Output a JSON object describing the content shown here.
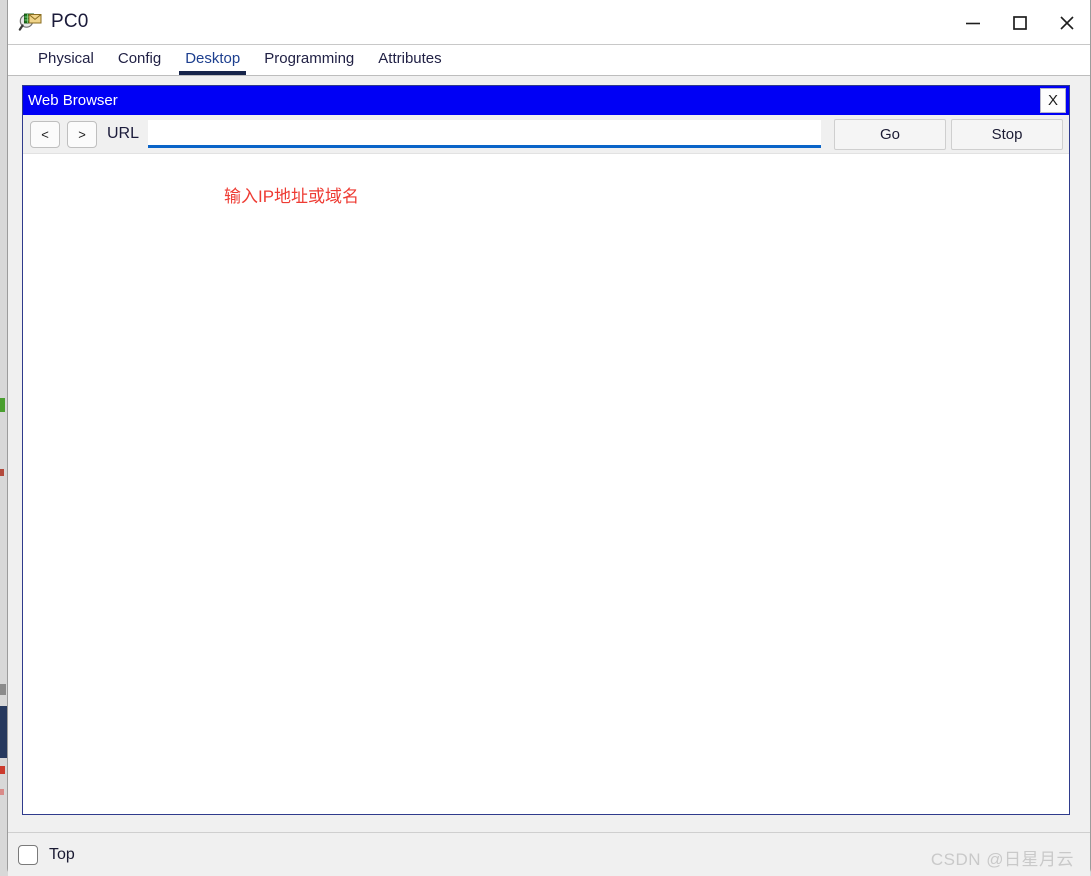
{
  "window": {
    "title": "PC0",
    "icon": "inspect-envelope-icon",
    "controls": {
      "minimize": "minimize-icon",
      "maximize": "maximize-icon",
      "close": "close-icon"
    }
  },
  "tabs": [
    {
      "label": "Physical",
      "selected": false
    },
    {
      "label": "Config",
      "selected": false
    },
    {
      "label": "Desktop",
      "selected": true
    },
    {
      "label": "Programming",
      "selected": false
    },
    {
      "label": "Attributes",
      "selected": false
    }
  ],
  "browser": {
    "caption": "Web Browser",
    "close_label": "X",
    "back_label": "<",
    "forward_label": ">",
    "url_label": "URL",
    "url_value": "",
    "url_placeholder": "",
    "go_label": "Go",
    "stop_label": "Stop",
    "annotation": "输入IP地址或域名"
  },
  "status": {
    "top_label": "Top",
    "top_checked": false
  },
  "watermark": "CSDN @日星月云",
  "colors": {
    "caption_blue": "#0000f5",
    "url_underline": "#0a64c8",
    "annotation_red": "#ee3b33",
    "tab_underline": "#16244a",
    "panel_border": "#2f3b8c"
  }
}
